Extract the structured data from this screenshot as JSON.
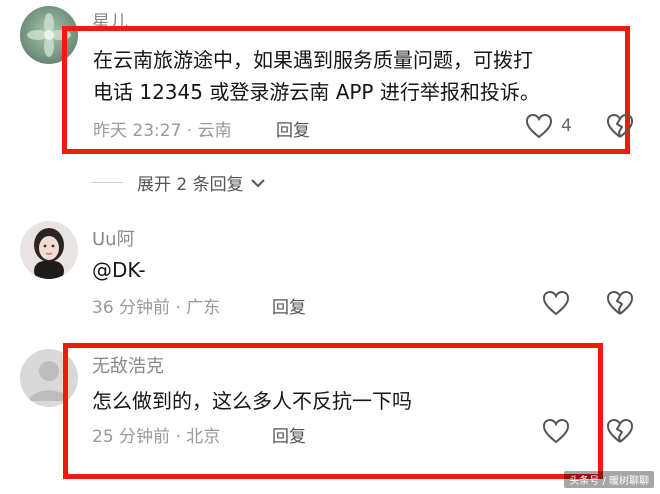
{
  "comments": [
    {
      "author": "星儿",
      "text_line1": "在云南旅游途中，如果遇到服务质量问题，可拨打",
      "text_line2": "电话 12345 或登录游云南 APP 进行举报和投诉。",
      "time": "昨天 23:27 · 云南",
      "reply_label": "回复",
      "likes": "4"
    },
    {
      "author": "Uu阿",
      "text_line1": "@DK-",
      "time": "36 分钟前 · 广东",
      "reply_label": "回复"
    },
    {
      "author": "无敌浩克",
      "text_line1": "怎么做到的，这么多人不反抗一下吗",
      "time": "25 分钟前 · 北京",
      "reply_label": "回复"
    }
  ],
  "expand_replies": "展开 2 条回复",
  "watermark": "头条号 / 暖树聊聊",
  "colors": {
    "highlight_box": "#ee1c0c",
    "meta_text": "#9a9a9a"
  }
}
